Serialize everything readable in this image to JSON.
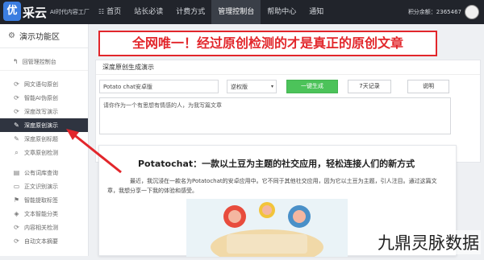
{
  "header": {
    "logo_char": "优",
    "brand": "采云",
    "slogan": "AI时代内容工厂",
    "nav": [
      {
        "label": "首页",
        "icon": "grid-icon",
        "glyph": "☷"
      },
      {
        "label": "站长必读",
        "icon": "",
        "glyph": ""
      },
      {
        "label": "计费方式",
        "icon": "",
        "glyph": ""
      },
      {
        "label": "管理控制台",
        "icon": "",
        "glyph": ""
      },
      {
        "label": "帮助中心",
        "icon": "",
        "glyph": ""
      },
      {
        "label": "通知",
        "icon": "",
        "glyph": ""
      }
    ],
    "active_nav": 3,
    "points_text": "积分余额：2365467"
  },
  "sidebar": {
    "title": "演示功能区",
    "back_label": "回管理控制台",
    "items": [
      {
        "label": "网文语句原创",
        "glyph": "⟳"
      },
      {
        "label": "智能AI伪原创",
        "glyph": "⟳"
      },
      {
        "label": "深度改写演示",
        "glyph": "⟳"
      },
      {
        "label": "深度原创演示",
        "glyph": "✎"
      },
      {
        "label": "深度原创标题",
        "glyph": "✎"
      },
      {
        "label": "文章原创检测",
        "glyph": "⌕"
      }
    ],
    "active_index": 3,
    "items2": [
      {
        "label": "公有词库查询",
        "glyph": "▤"
      },
      {
        "label": "正文识别演示",
        "glyph": "▭"
      },
      {
        "label": "智能提取标签",
        "glyph": "⚑"
      },
      {
        "label": "文本智能分类",
        "glyph": "◈"
      },
      {
        "label": "内容相关检测",
        "glyph": "⟳"
      },
      {
        "label": "自动文本摘要",
        "glyph": "⟳"
      }
    ]
  },
  "banner": "全网唯一！经过原创检测的才是真正的原创文章",
  "panel": {
    "title": "深度原创生成演示",
    "keyword_value": "Potato chat安卓版",
    "mode_value": "逆权版",
    "generate_label": "一键生成",
    "history_label": "7天记录",
    "help_label": "说明",
    "prompt_text": "请你作为一个有思想有情感的人，为我写篇文章"
  },
  "article": {
    "title": "Potatochat：一款以土豆为主题的社交应用，轻松连接人们的新方式",
    "body": "最近，我沉浸在一款名为Potatochat的安卓应用中。它不同于其他社交应用，因为它以土豆为主题，引人注目。通过这篇文章，我想分享一下我的体验和感受。"
  },
  "watermark": "九鼎灵脉数据",
  "colors": {
    "accent_red": "#e2262b",
    "green": "#4cc35a",
    "topbar": "#21242b",
    "active_nav": "#3a3f48"
  }
}
